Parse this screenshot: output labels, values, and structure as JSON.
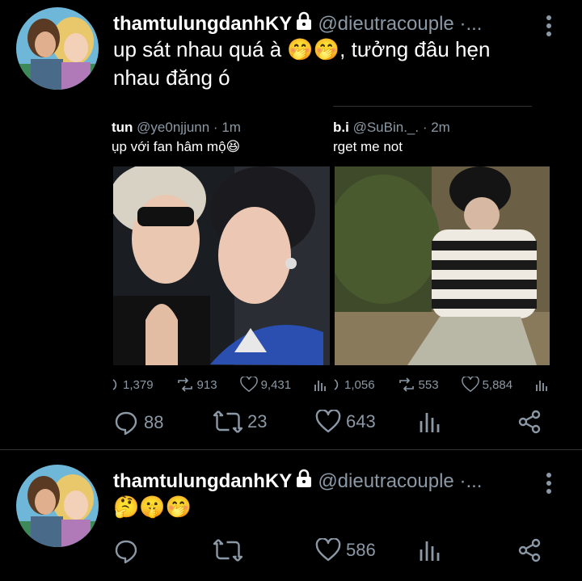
{
  "tweets": [
    {
      "name": "thamtulungdanhKY",
      "handle": "@dieutracouple ·...",
      "text_line1": "up sát nhau quá à 🤭🤭, tưởng đâu hẹn",
      "text_line2": "nhau đăng ó",
      "reply_count": "88",
      "retweet_count": "23",
      "like_count": "643"
    },
    {
      "name": "thamtulungdanhKY",
      "handle": "@dieutracouple ·...",
      "text": "🤔🤫🤭",
      "reply_count": "",
      "retweet_count": "",
      "like_count": "586"
    }
  ],
  "quoted": [
    {
      "name": "tun",
      "handle": "@ye0njjunn · 1m",
      "text": "ụp với fan hâm mộ😆",
      "reply_count": "1,379",
      "retweet_count": "913",
      "like_count": "9,431"
    },
    {
      "name": "b.i",
      "handle": "@SuBin._. · 2m",
      "text": "rget me not",
      "reply_count": "1,056",
      "retweet_count": "553",
      "like_count": "5,884"
    }
  ],
  "colors": {
    "background": "#000000",
    "text": "#ffffff",
    "muted": "#8b98a5",
    "divider": "#2f3336"
  },
  "icons": [
    "lock-icon",
    "more-vertical-icon",
    "reply-icon",
    "retweet-icon",
    "like-icon",
    "analytics-icon",
    "share-icon"
  ]
}
